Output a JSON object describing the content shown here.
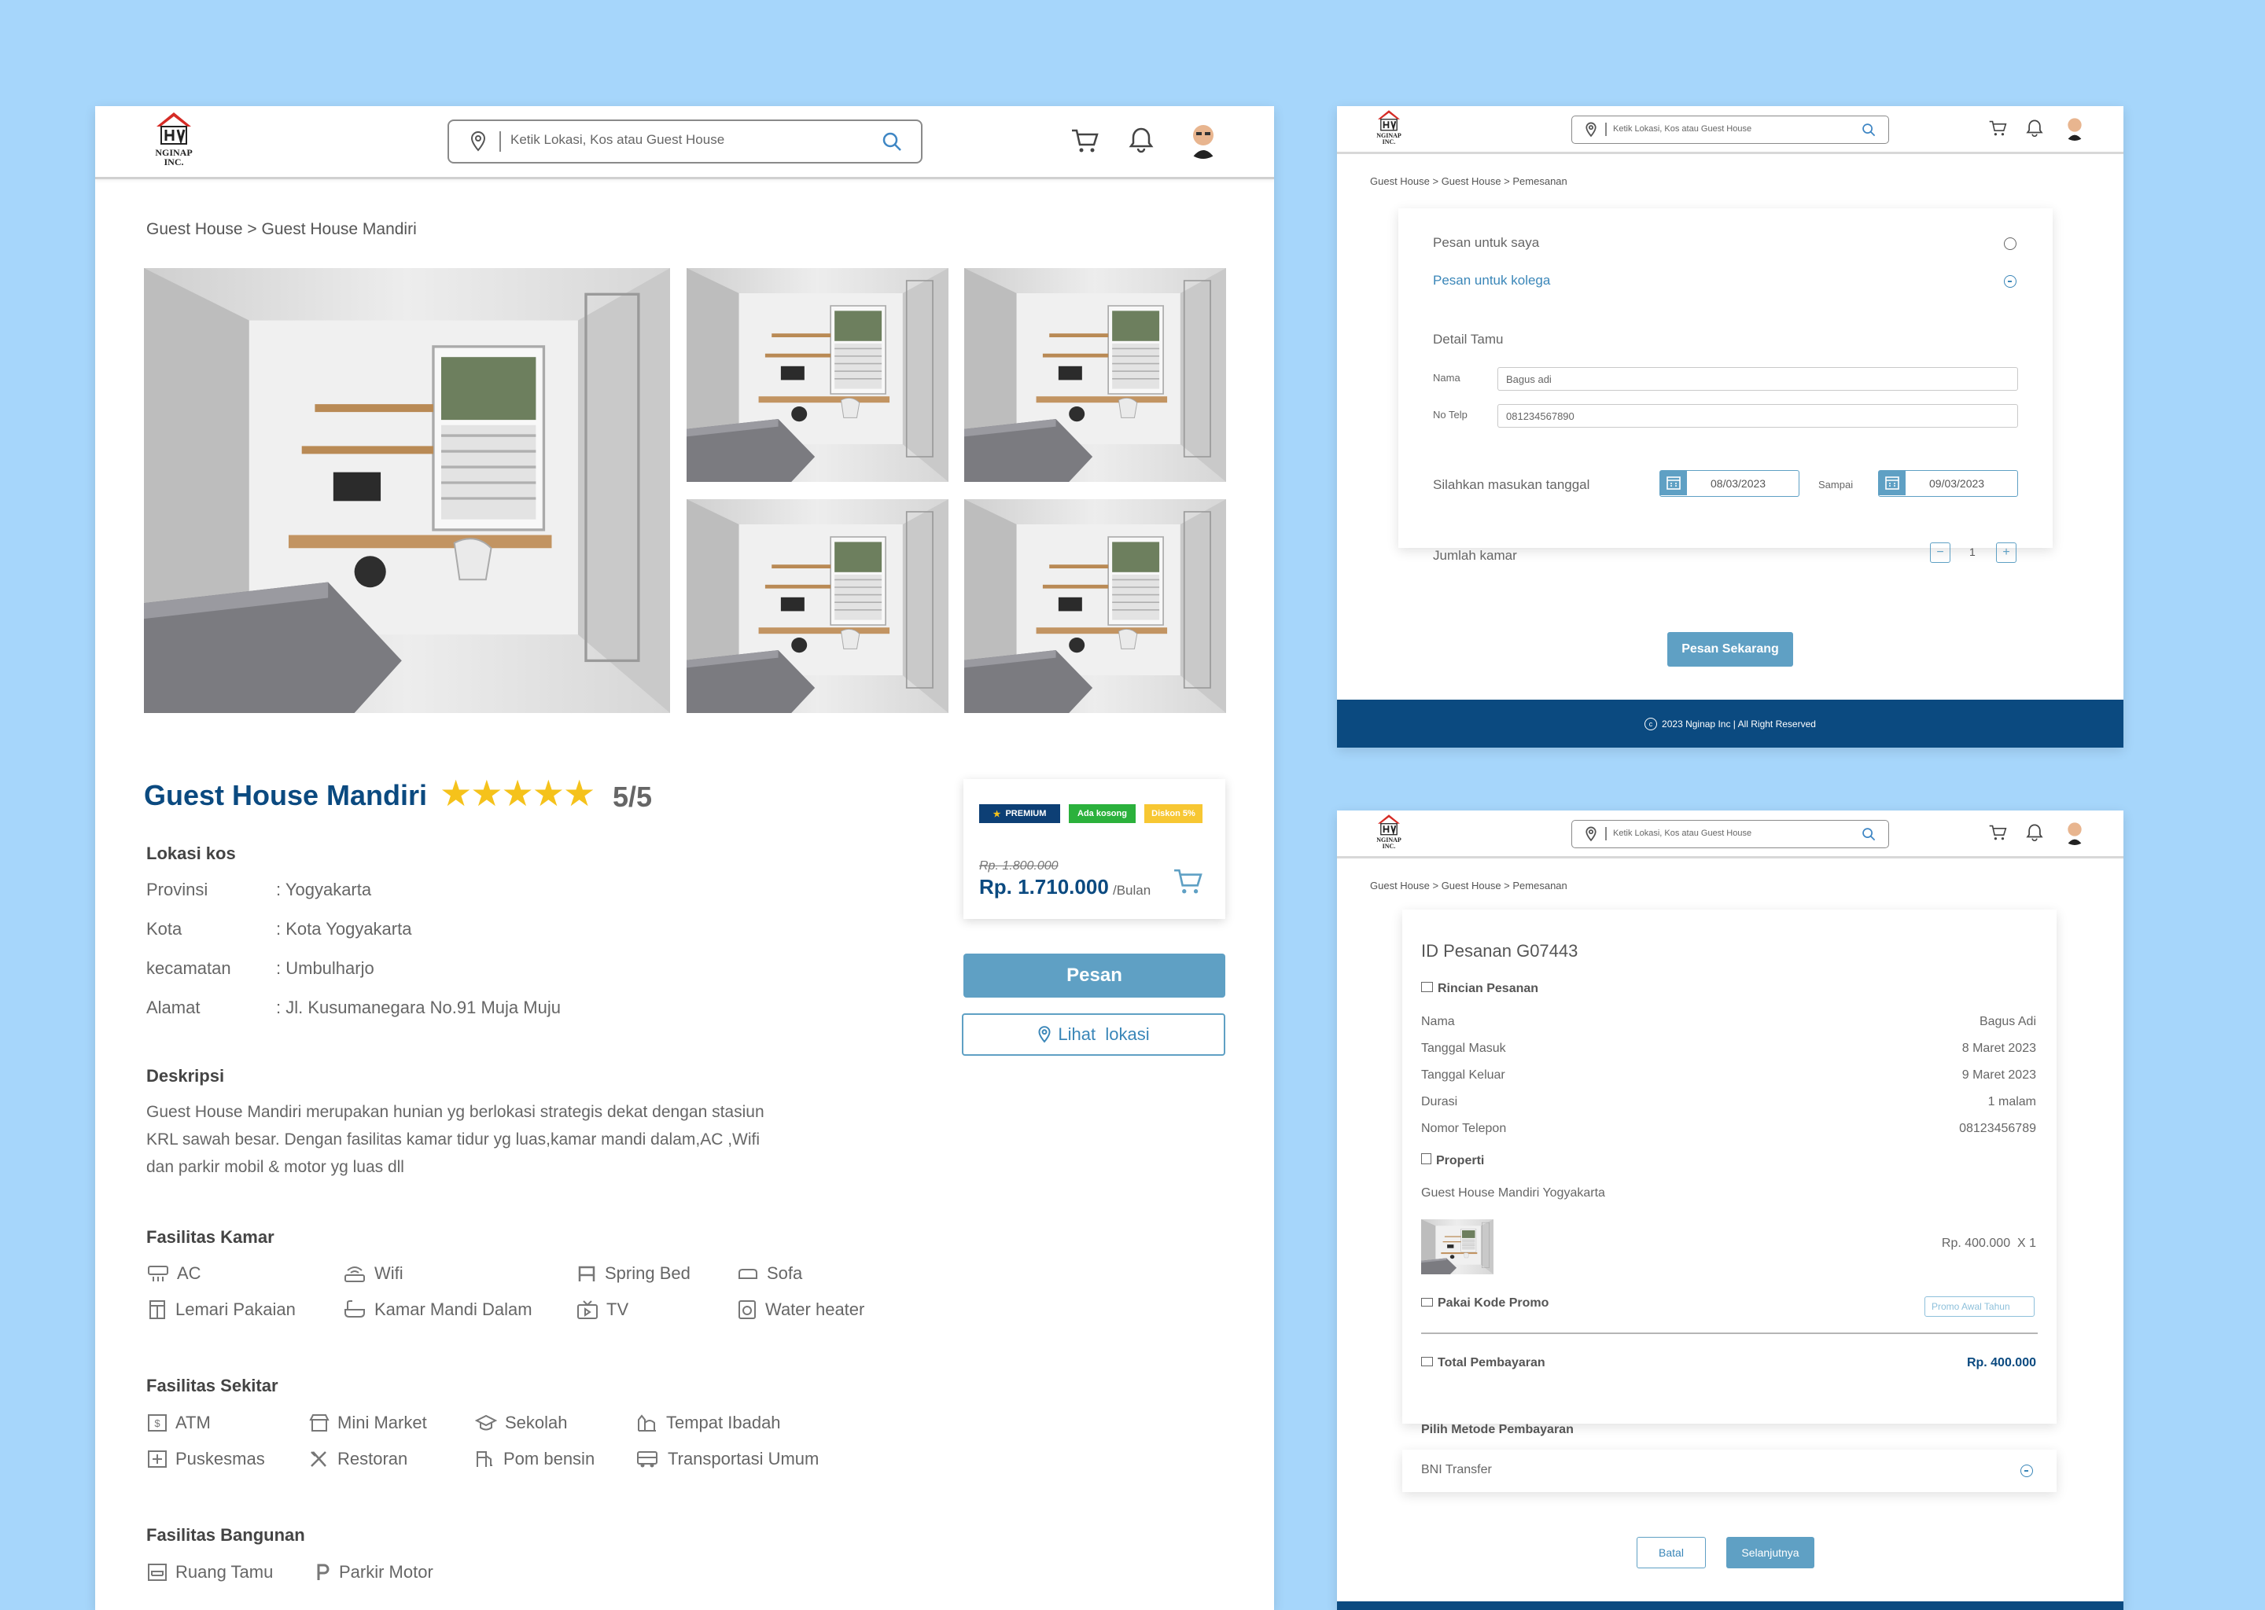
{
  "header": {
    "logo_text": "NGINAP INC.",
    "search_placeholder": "Ketik Lokasi, Kos atau Guest House"
  },
  "detail": {
    "breadcrumb": "Guest House > Guest House Mandiri",
    "title": "Guest House Mandiri",
    "rating_stars": 5,
    "rating_text": "5/5",
    "location_heading": "Lokasi kos",
    "location": [
      {
        "label": "Provinsi",
        "value": ": Yogyakarta"
      },
      {
        "label": "Kota",
        "value": ": Kota Yogyakarta"
      },
      {
        "label": "kecamatan",
        "value": ": Umbulharjo"
      },
      {
        "label": "Alamat",
        "value": ": Jl. Kusumanegara No.91 Muja Muju"
      }
    ],
    "description_heading": "Deskripsi",
    "description_lines": [
      "Guest House Mandiri merupakan hunian yg berlokasi strategis dekat dengan stasiun",
      "KRL sawah besar. Dengan fasilitas kamar tidur yg luas,kamar mandi dalam,AC ,Wifi",
      "dan parkir mobil & motor yg luas dll"
    ],
    "room_facilities_heading": "Fasilitas  Kamar",
    "room_facilities": [
      {
        "label": "AC",
        "icon": "ac-icon"
      },
      {
        "label": "Wifi",
        "icon": "wifi-router-icon"
      },
      {
        "label": "Spring Bed",
        "icon": "bed-icon"
      },
      {
        "label": "Sofa",
        "icon": "sofa-icon"
      },
      {
        "label": "Lemari Pakaian",
        "icon": "wardrobe-icon"
      },
      {
        "label": "Kamar Mandi Dalam",
        "icon": "bathtub-icon"
      },
      {
        "label": "TV",
        "icon": "tv-icon"
      },
      {
        "label": "Water heater",
        "icon": "water-heater-icon"
      }
    ],
    "nearby_heading": "Fasilitas Sekitar",
    "nearby": [
      {
        "label": "ATM",
        "icon": "atm-icon"
      },
      {
        "label": "Mini Market",
        "icon": "store-icon"
      },
      {
        "label": "Sekolah",
        "icon": "school-icon"
      },
      {
        "label": "Tempat Ibadah",
        "icon": "worship-icon"
      },
      {
        "label": "Puskesmas",
        "icon": "health-icon"
      },
      {
        "label": "Restoran",
        "icon": "restaurant-icon"
      },
      {
        "label": "Pom bensin",
        "icon": "gas-station-icon"
      },
      {
        "label": "Transportasi Umum",
        "icon": "bus-icon"
      }
    ],
    "building_heading": "Fasilitas Bangunan",
    "building": [
      {
        "label": "Ruang Tamu",
        "icon": "living-room-icon"
      },
      {
        "label": "Parkir Motor",
        "icon": "parking-icon"
      }
    ],
    "price_card": {
      "badges": [
        "PREMIUM",
        "Ada kosong",
        "Diskon 5%"
      ],
      "old_price": "Rp. 1.800.000",
      "price": "Rp. 1.710.000",
      "per": "/Bulan"
    },
    "order_button": "Pesan",
    "location_button": "Lihat  lokasi"
  },
  "booking": {
    "breadcrumb": "Guest House > Guest House > Pemesanan",
    "option_self": "Pesan untuk saya",
    "option_colleague": "Pesan untuk kolega",
    "guest_heading": "Detail Tamu",
    "name_label": "Nama",
    "name_value": "Bagus adi",
    "phone_label": "No Telp",
    "phone_value": "081234567890",
    "date_label": "Silahkan masukan tanggal",
    "date_from": "08/03/2023",
    "until_label": "Sampai",
    "date_to": "09/03/2023",
    "rooms_label": "Jumlah kamar",
    "rooms_value": "1",
    "submit": "Pesan Sekarang",
    "footer": "2023 Nginap Inc | All Right Reserved"
  },
  "summary": {
    "breadcrumb": "Guest House > Guest House > Pemesanan",
    "order_id": "ID Pesanan G07443",
    "details_heading": "Rincian Pesanan",
    "rows": [
      {
        "label": "Nama",
        "value": "Bagus Adi"
      },
      {
        "label": "Tanggal Masuk",
        "value": "8 Maret 2023"
      },
      {
        "label": "Tanggal Keluar",
        "value": "9 Maret 2023"
      },
      {
        "label": "Durasi",
        "value": "1 malam"
      },
      {
        "label": "Nomor Telepon",
        "value": "08123456789"
      }
    ],
    "property_heading": "Properti",
    "property_name": "Guest House Mandiri Yogyakarta",
    "property_price": "Rp. 400.000",
    "property_qty": "X 1",
    "promo_label": "Pakai Kode Promo",
    "promo_value": "Promo Awal Tahun",
    "total_label": "Total Pembayaran",
    "total_value": "Rp. 400.000",
    "payment_heading": "Pilih Metode Pembayaran",
    "payment_method": "BNI Transfer",
    "cancel": "Batal",
    "next": "Selanjutnya"
  },
  "colors": {
    "brand_blue": "#0b4a80",
    "accent": "#5fa0c4",
    "star": "#f5c21b",
    "badge_premium": "#0d3f75",
    "badge_available": "#2bb13c",
    "badge_discount": "#f7c733"
  }
}
